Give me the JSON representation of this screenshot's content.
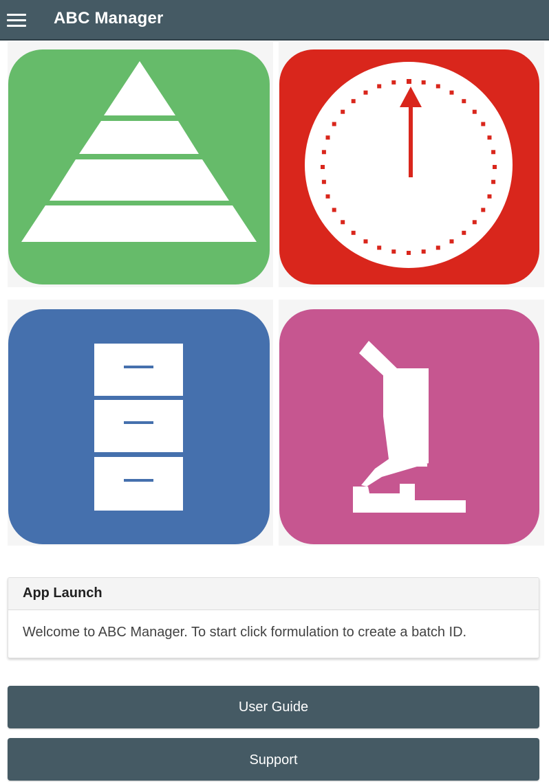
{
  "header": {
    "title": "ABC Manager",
    "menu_icon": "hamburger-menu-icon",
    "background": "#455a64"
  },
  "tiles": [
    {
      "icon": "pyramid-icon",
      "color": "#66bb6a"
    },
    {
      "icon": "clock-icon",
      "color": "#d9261c"
    },
    {
      "icon": "filing-cabinet-icon",
      "color": "#4570ad"
    },
    {
      "icon": "microscope-icon",
      "color": "#c65690"
    }
  ],
  "card": {
    "title": "App Launch",
    "message": "Welcome to ABC Manager. To start click formulation to create a batch ID."
  },
  "buttons": {
    "user_guide": "User Guide",
    "support": "Support"
  }
}
